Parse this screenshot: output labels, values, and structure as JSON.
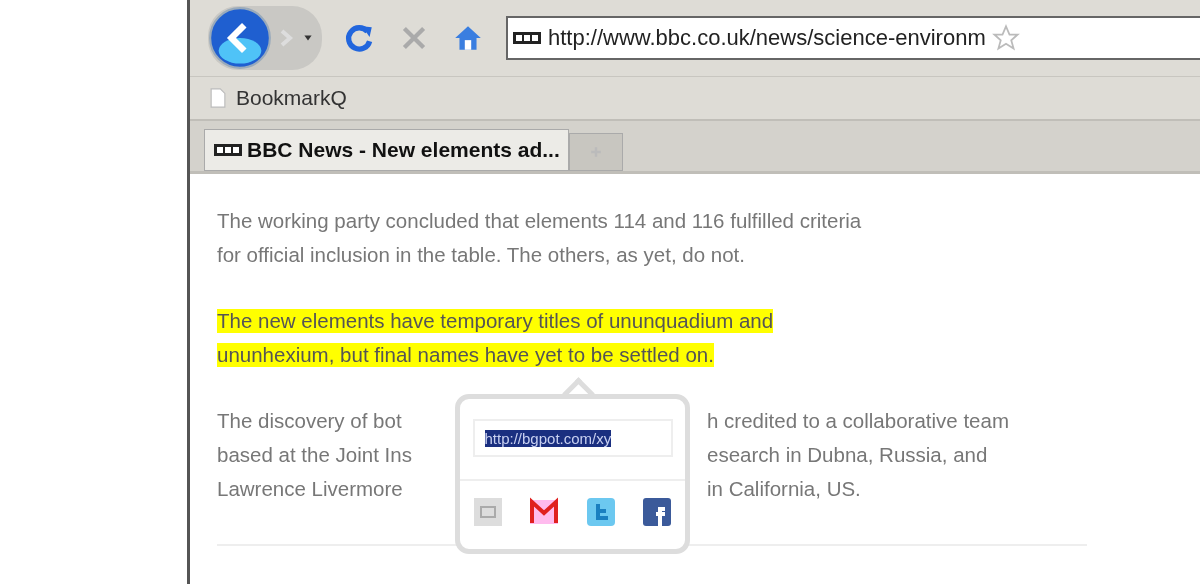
{
  "toolbar": {
    "url": "http://www.bbc.co.uk/news/science-environm"
  },
  "bookmarks": [
    {
      "label": "BookmarkQ"
    }
  ],
  "tabs": [
    {
      "label": "BBC News - New elements ad...",
      "selected": true
    }
  ],
  "article": {
    "paragraphs": [
      {
        "kind": "plain",
        "lines": [
          {
            "left": "The working party concluded that elements 114 and 116 fulfilled criteria"
          },
          {
            "left": "for official inclusion in the table. The others, as yet, do not."
          }
        ]
      },
      {
        "kind": "highlight",
        "lines": [
          {
            "left": "The new elements have temporary titles of ununquadium and"
          },
          {
            "left": "ununhexium, but final names have yet to be settled on."
          }
        ]
      },
      {
        "kind": "covered",
        "lines": [
          {
            "left": "The discovery of bot",
            "right": "h credited to a collaborative team"
          },
          {
            "left": "based at the Joint Ins",
            "right": "esearch in Dubna, Russia, and"
          },
          {
            "left": "Lawrence Livermore",
            "right": "in California, US."
          }
        ]
      }
    ]
  },
  "share_popup": {
    "link": "http://bgpot.com/xy",
    "link_selected": true
  }
}
